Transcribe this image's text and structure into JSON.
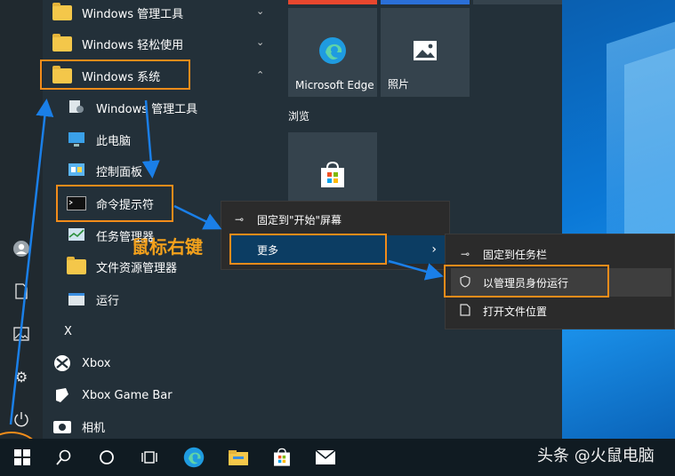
{
  "apps": {
    "admin_tools": "Windows 管理工具",
    "ease_access": "Windows 轻松使用",
    "windows_system": "Windows 系统",
    "sub_admin_tools": "Windows 管理工具",
    "this_pc": "此电脑",
    "control_panel": "控制面板",
    "cmd": "命令提示符",
    "task_manager": "任务管理器",
    "file_explorer": "文件资源管理器",
    "run": "运行",
    "letter_x": "X",
    "xbox": "Xbox",
    "xbox_game_bar": "Xbox Game Bar",
    "camera": "相机"
  },
  "tiles": {
    "edge_label": "Microsoft Edge",
    "photos_label": "照片",
    "browse_header": "浏览"
  },
  "context_menu": {
    "pin_start": "固定到\"开始\"屏幕",
    "more": "更多"
  },
  "submenu": {
    "pin_taskbar": "固定到任务栏",
    "run_as_admin": "以管理员身份运行",
    "open_location": "打开文件位置"
  },
  "annotation": {
    "right_click": "鼠标右键"
  },
  "watermark": "头条 @火鼠电脑",
  "icons": [
    "user-icon",
    "document-icon",
    "pictures-icon",
    "settings-icon",
    "power-icon",
    "start-icon",
    "search-icon",
    "cortana-icon",
    "task-view-icon",
    "edge-icon",
    "explorer-icon",
    "store-icon",
    "mail-icon",
    "chevron-down-icon",
    "chevron-up-icon",
    "chevron-right-icon"
  ],
  "colors": {
    "highlight": "#f28c1a",
    "menu_selected": "#0c3d63",
    "arrow": "#1a7fe8"
  }
}
